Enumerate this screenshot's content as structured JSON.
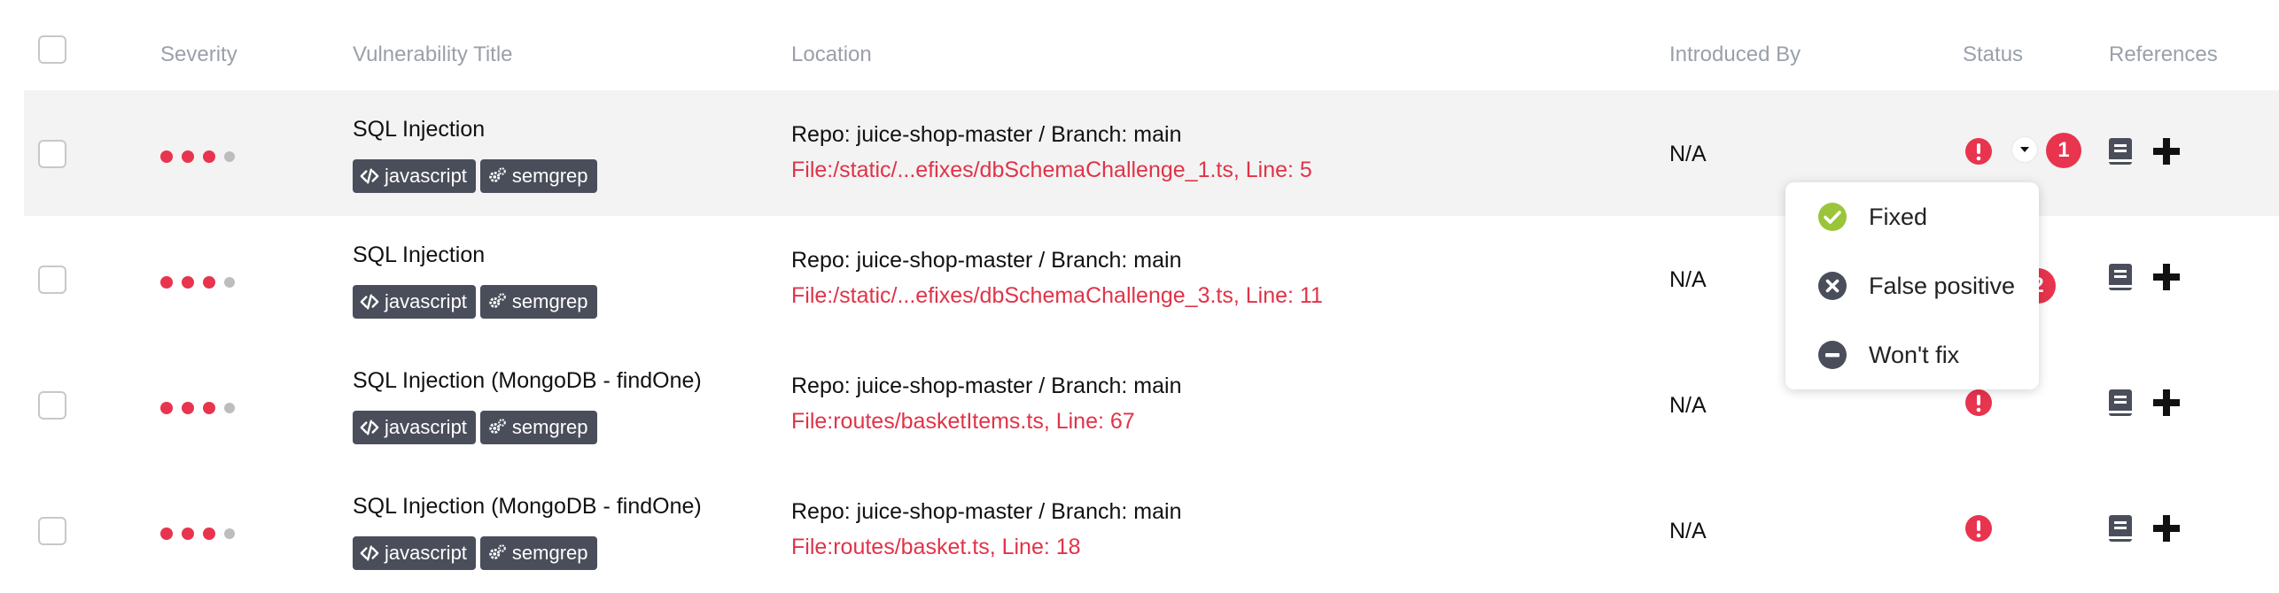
{
  "table": {
    "columns": [
      "Severity",
      "Vulnerability Title",
      "Location",
      "Introduced By",
      "Status",
      "References"
    ],
    "rows": [
      {
        "title": "SQL Injection",
        "tags": [
          "javascript",
          "semgrep"
        ],
        "repo": "Repo: juice-shop-master / Branch: main",
        "file": "File:/static/...efixes/dbSchemaChallenge_1.ts, Line: 5",
        "introduced_by": "N/A",
        "severity_level": 3,
        "severity_max": 4
      },
      {
        "title": "SQL Injection",
        "tags": [
          "javascript",
          "semgrep"
        ],
        "repo": "Repo: juice-shop-master / Branch: main",
        "file": "File:/static/...efixes/dbSchemaChallenge_3.ts, Line: 11",
        "introduced_by": "N/A",
        "severity_level": 3,
        "severity_max": 4
      },
      {
        "title": "SQL Injection (MongoDB - findOne)",
        "tags": [
          "javascript",
          "semgrep"
        ],
        "repo": "Repo: juice-shop-master / Branch: main",
        "file": "File:routes/basketItems.ts, Line: 67",
        "introduced_by": "N/A",
        "severity_level": 3,
        "severity_max": 4
      },
      {
        "title": "SQL Injection (MongoDB - findOne)",
        "tags": [
          "javascript",
          "semgrep"
        ],
        "repo": "Repo: juice-shop-master / Branch: main",
        "file": "File:routes/basket.ts, Line: 18",
        "introduced_by": "N/A",
        "severity_level": 3,
        "severity_max": 4
      }
    ]
  },
  "status_menu": {
    "items": [
      {
        "label": "Fixed",
        "icon": "check-circle-icon"
      },
      {
        "label": "False positive",
        "icon": "x-circle-icon"
      },
      {
        "label": "Won't fix",
        "icon": "minus-circle-icon"
      }
    ]
  },
  "annotations": {
    "badge1": "1",
    "badge2": "2"
  },
  "colors": {
    "severity": "#e8344e",
    "file_link": "#e03348",
    "tag_bg": "#4a4e5a",
    "fixed": "#9ac53b",
    "row_highlight": "#f3f3f3"
  },
  "icons": {
    "status": "exclamation-circle-icon",
    "reference": "book-icon",
    "add": "plus-icon",
    "code": "code-icon",
    "tool": "gears-icon"
  }
}
